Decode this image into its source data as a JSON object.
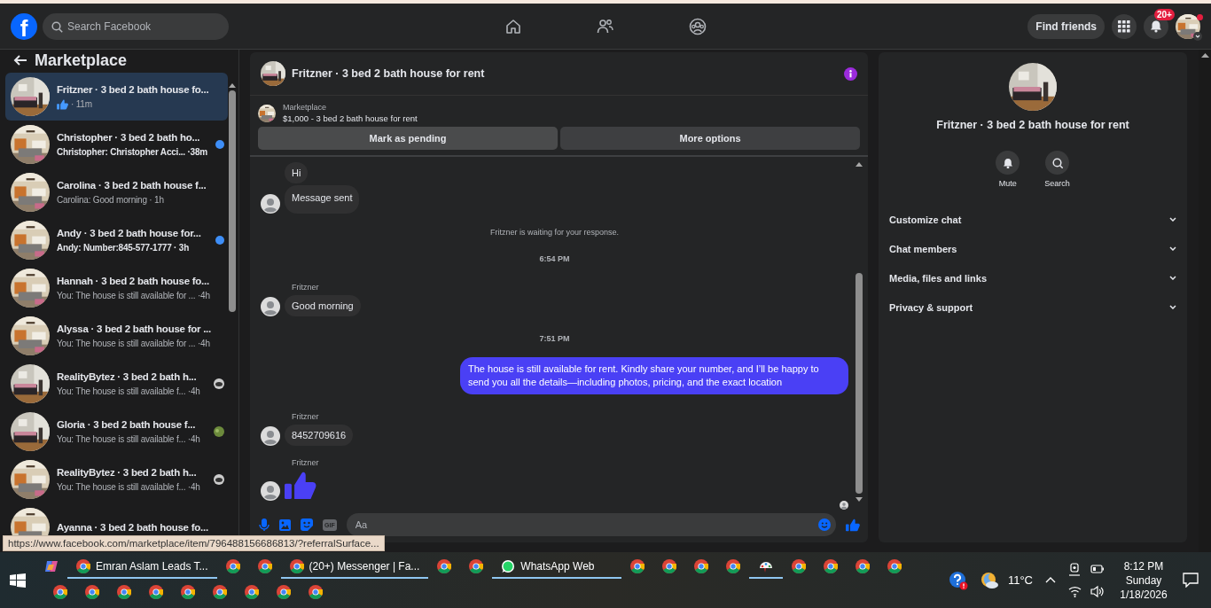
{
  "header": {
    "logo": "f",
    "search": {
      "placeholder": "Search Facebook"
    },
    "nav": [
      {
        "kind": "home"
      },
      {
        "kind": "friends"
      },
      {
        "kind": "groups"
      }
    ],
    "find_friends": "Find friends",
    "notifications_badge": "20+"
  },
  "sidebar": {
    "title": "Marketplace",
    "conversations": [
      {
        "title": "Fritzner · 3 bed 2 bath house fo...",
        "kind": "like",
        "preview": "· 11m",
        "selected": true,
        "unread": false,
        "seen": false
      },
      {
        "title": "Christopher · 3 bed 2 bath ho...",
        "preview": "Christopher: Christopher Acci... ·38m",
        "selected": false,
        "unread": true,
        "seen": false
      },
      {
        "title": "Carolina · 3 bed 2 bath house f...",
        "preview": "Carolina: Good morning · 1h",
        "selected": false,
        "unread": false,
        "seen": false
      },
      {
        "title": "Andy · 3 bed 2 bath house for...",
        "preview": "Andy: Number:845-577-1777 · 3h",
        "selected": false,
        "unread": true,
        "seen": false
      },
      {
        "title": "Hannah · 3 bed 2 bath house fo...",
        "preview": "You: The house is still available for ... ·4h",
        "selected": false,
        "unread": false,
        "seen": false
      },
      {
        "title": "Alyssa · 3 bed 2 bath house for ...",
        "preview": "You: The house is still available for ... ·4h",
        "selected": false,
        "unread": false,
        "seen": false
      },
      {
        "title": "RealityBytez · 3 bed 2 bath h...",
        "preview": "You: The house is still available f... ·4h",
        "selected": false,
        "unread": false,
        "seen": true
      },
      {
        "title": "Gloria · 3 bed 2 bath house f...",
        "preview": "You: The house is still available f... ·4h",
        "selected": false,
        "unread": false,
        "seen": true
      },
      {
        "title": "RealityBytez · 3 bed 2 bath h...",
        "preview": "You: The house is still available f... ·4h",
        "selected": false,
        "unread": false,
        "seen": true
      },
      {
        "title": "Ayanna · 3 bed 2 bath house fo...",
        "selected": false,
        "unread": false,
        "seen": false
      }
    ]
  },
  "chat": {
    "title": "Fritzner · 3 bed 2 bath house for rent",
    "listing": {
      "source": "Marketplace",
      "item": "$1,000 - 3 bed 2 bath house for rent"
    },
    "actions": [
      "Mark as pending",
      "More options"
    ],
    "messages": [
      {
        "kind": "incoming",
        "text": "Hi",
        "avatar": false
      },
      {
        "kind": "incoming",
        "text": "Message sent",
        "avatar": true
      },
      {
        "kind": "notice",
        "text": "Fritzner is waiting for your response."
      },
      {
        "kind": "time",
        "text": "6:54 PM"
      },
      {
        "kind": "sender",
        "text": "Fritzner"
      },
      {
        "kind": "incoming",
        "text": "Good morning",
        "avatar": true
      },
      {
        "kind": "time",
        "text": "7:51 PM"
      },
      {
        "kind": "outgoing",
        "text": "The house is still available for rent. Kindly share your number, and I’ll be happy to send you all the details—including photos, pricing, and the exact location"
      },
      {
        "kind": "sender",
        "text": "Fritzner"
      },
      {
        "kind": "incoming",
        "text": "8452709616",
        "avatar": true
      },
      {
        "kind": "sender",
        "text": "Fritzner"
      },
      {
        "kind": "like",
        "avatar": true
      }
    ],
    "composer": {
      "gif": "GIF",
      "placeholder": "Aa"
    }
  },
  "details": {
    "title": "Fritzner · 3 bed 2 bath house for rent",
    "actions": [
      {
        "kind": "mute",
        "label": "Mute"
      },
      {
        "kind": "search",
        "label": "Search"
      }
    ],
    "sections": [
      "Customize chat",
      "Chat members",
      "Media, files and links",
      "Privacy & support"
    ]
  },
  "status_url": "https://www.facebook.com/marketplace/item/796488156686813/?referralSurface...",
  "taskbar": {
    "row_1": [
      {
        "kind": "copilot",
        "running": false
      },
      {
        "kind": "browser",
        "label": "Emran Aslam Leads T...",
        "running": true
      },
      {
        "kind": "browser",
        "running": false
      },
      {
        "kind": "browser",
        "running": false
      },
      {
        "kind": "browser",
        "label": "(20+) Messenger | Fa...",
        "running": true
      },
      {
        "kind": "browser",
        "running": false
      },
      {
        "kind": "browser",
        "running": false
      },
      {
        "kind": "whatsapp",
        "label": "WhatsApp Web",
        "running": true
      },
      {
        "kind": "browser",
        "running": false
      },
      {
        "kind": "browser",
        "running": false
      },
      {
        "kind": "browser",
        "running": false
      },
      {
        "kind": "browser",
        "running": false
      },
      {
        "kind": "paint",
        "running": true
      },
      {
        "kind": "browser",
        "running": false
      },
      {
        "kind": "browser",
        "running": false
      },
      {
        "kind": "browser",
        "running": false
      },
      {
        "kind": "browser",
        "running": false
      }
    ],
    "row_2": [
      {
        "kind": "browser",
        "running": false
      },
      {
        "kind": "browser",
        "running": false
      },
      {
        "kind": "browser",
        "running": false
      },
      {
        "kind": "browser",
        "running": false
      },
      {
        "kind": "browser",
        "running": false
      },
      {
        "kind": "browser",
        "running": false
      },
      {
        "kind": "browser",
        "running": false
      },
      {
        "kind": "browser",
        "running": false
      },
      {
        "kind": "browser",
        "running": false
      }
    ],
    "tray": {
      "temperature": "11°C",
      "time": "8:12 PM",
      "day": "Sunday",
      "date": "1/18/2026"
    }
  }
}
